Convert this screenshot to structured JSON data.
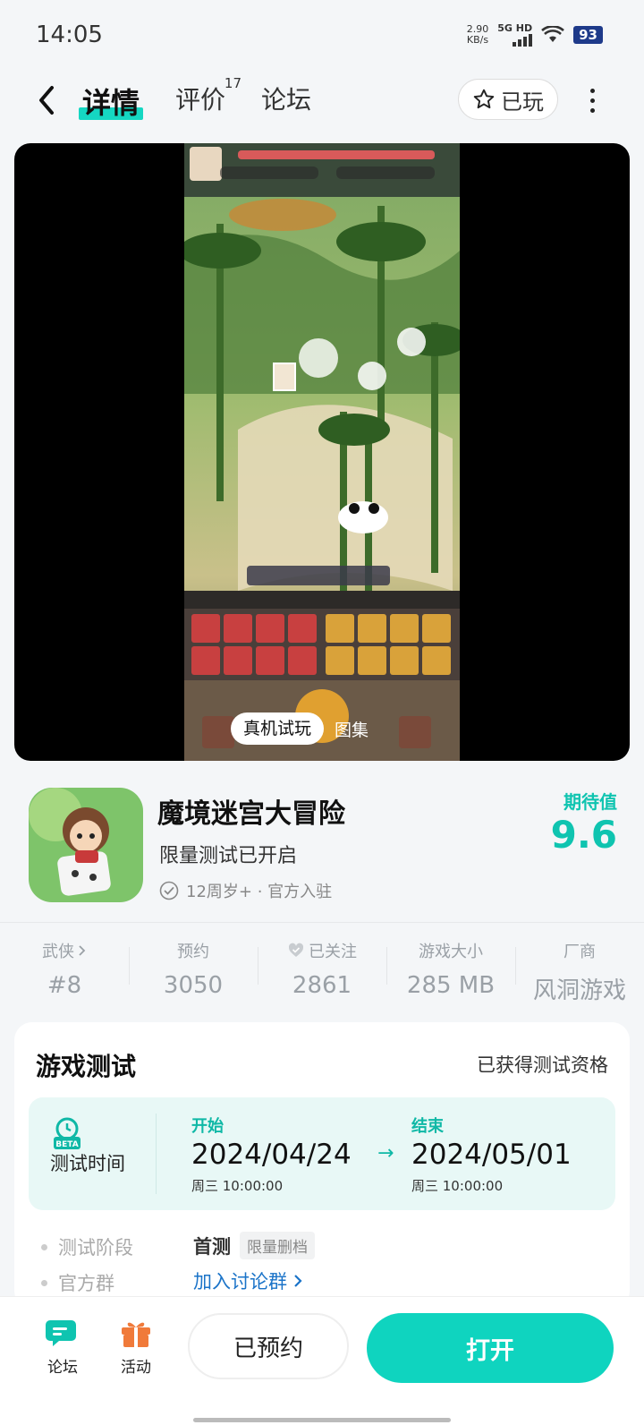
{
  "status_bar": {
    "time": "14:05",
    "net_speed_value": "2.90",
    "net_speed_unit": "KB/s",
    "network": "5G HD",
    "battery": "93"
  },
  "nav": {
    "tabs": [
      {
        "label": "详情",
        "active": true
      },
      {
        "label": "评价",
        "badge": "17"
      },
      {
        "label": "论坛"
      }
    ],
    "played_label": "已玩"
  },
  "media": {
    "tabs": [
      "真机试玩",
      "图集"
    ]
  },
  "app": {
    "title": "魔境迷宫大冒险",
    "subtitle": "限量测试已开启",
    "meta": "12周岁+ · 官方入驻",
    "expect_label": "期待值",
    "expect_value": "9.6"
  },
  "stats": [
    {
      "label": "武侠",
      "value": "#8"
    },
    {
      "label": "预约",
      "value": "3050"
    },
    {
      "label": "已关注",
      "value": "2861"
    },
    {
      "label": "游戏大小",
      "value": "285 MB"
    },
    {
      "label": "厂商",
      "value": "风洞游戏"
    }
  ],
  "test_card": {
    "title": "游戏测试",
    "status": "已获得测试资格",
    "time_label": "测试时间",
    "start_head": "开始",
    "start_date": "2024/04/24",
    "start_sub": "周三  10:00:00",
    "end_head": "结束",
    "end_date": "2024/05/01",
    "end_sub": "周三  10:00:00",
    "beta_text": "BETA",
    "stage_label": "测试阶段",
    "stage_value": "首测",
    "stage_tag": "限量删档",
    "group_label": "官方群",
    "group_link": "加入讨论群"
  },
  "bottom_bar": {
    "forum_label": "论坛",
    "activity_label": "活动",
    "reserved_label": "已预约",
    "open_label": "打开"
  },
  "colors": {
    "accent": "#0fd4bf",
    "link": "#1a73c8"
  }
}
